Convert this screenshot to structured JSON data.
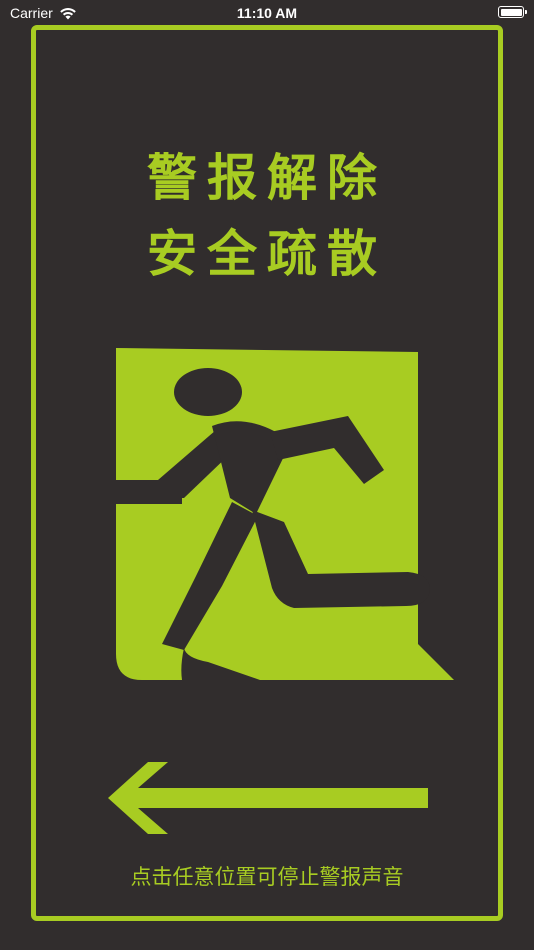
{
  "status_bar": {
    "carrier": "Carrier",
    "time": "11:10 AM",
    "wifi_icon": "wifi-icon",
    "battery_icon": "battery-icon",
    "battery_level": 1.0
  },
  "sign": {
    "line1": "警报解除",
    "line2": "安全疏散",
    "exit_icon": "running-man-exit-icon",
    "direction_icon": "arrow-left-icon",
    "hint": "点击任意位置可停止警报声音"
  },
  "colors": {
    "background": "#312d2d",
    "accent": "#a8cc22",
    "status_text": "#ffffff"
  }
}
